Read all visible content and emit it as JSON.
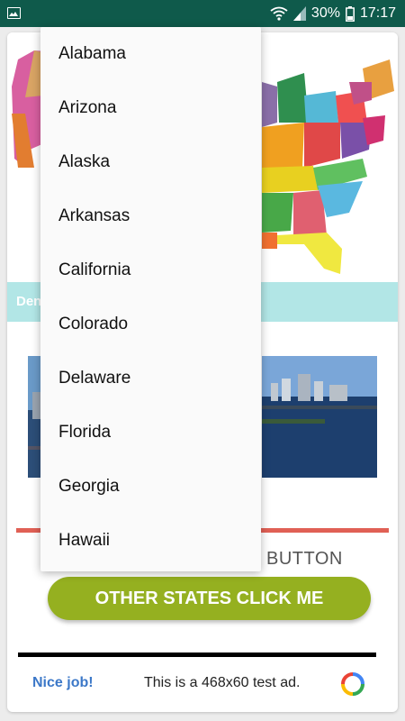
{
  "status_bar": {
    "battery": "30%",
    "time": "17:17",
    "icons": [
      "image-icon",
      "wifi-icon",
      "signal-icon",
      "battery-icon"
    ]
  },
  "banner": {
    "text": "Den"
  },
  "dropdown": {
    "options": [
      "Alabama",
      "Arizona",
      "Alaska",
      "Arkansas",
      "California",
      "Colorado",
      "Delaware",
      "Florida",
      "Georgia",
      "Hawaii"
    ]
  },
  "button_caption": "BUTTON",
  "cta_label": "OTHER STATES CLICK ME",
  "ad": {
    "nice": "Nice job!",
    "message": "This is a 468x60 test ad."
  },
  "colors": {
    "status_bar": "#0f5a4b",
    "banner": "#b2e6e6",
    "cta": "#95b020",
    "red_line": "#e06055",
    "ad_link": "#3c78c8"
  }
}
